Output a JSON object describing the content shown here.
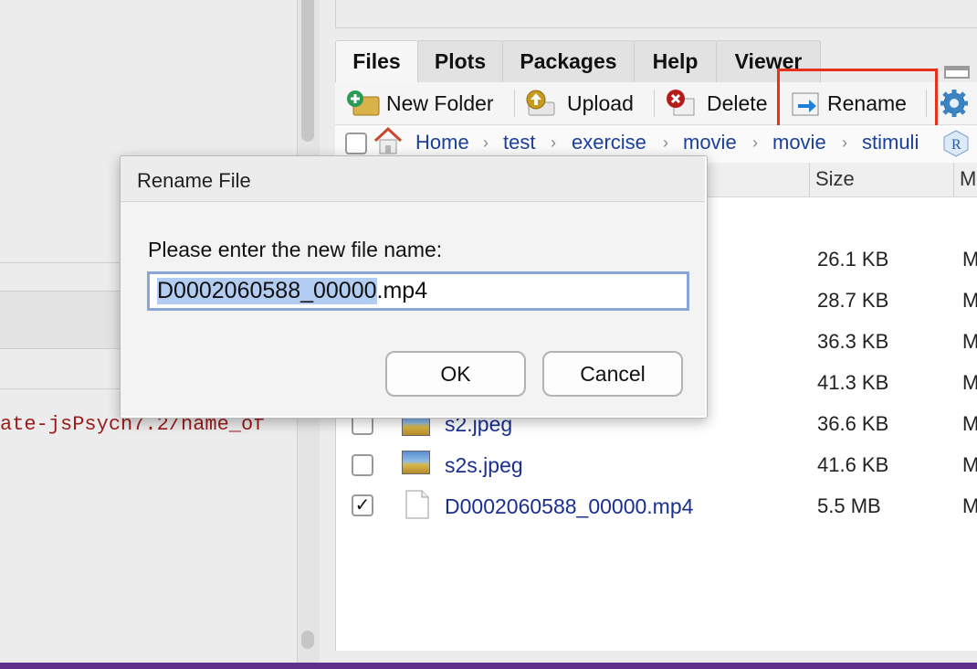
{
  "left_pane": {
    "code_snippet": "ate-jsPsych7.2/name_of"
  },
  "files_pane": {
    "tabs": [
      {
        "label": "Files",
        "active": true
      },
      {
        "label": "Plots",
        "active": false
      },
      {
        "label": "Packages",
        "active": false
      },
      {
        "label": "Help",
        "active": false
      },
      {
        "label": "Viewer",
        "active": false
      }
    ],
    "toolbar": {
      "new_folder": "New Folder",
      "upload": "Upload",
      "delete": "Delete",
      "rename": "Rename"
    },
    "breadcrumb": [
      "Home",
      "test",
      "exercise",
      "movie",
      "movie",
      "stimuli"
    ],
    "columns": {
      "size": "Size",
      "modified": "M"
    },
    "rows": [
      {
        "name": "",
        "size": "26.1 KB",
        "modified": "M",
        "checked": false
      },
      {
        "name": "",
        "size": "28.7 KB",
        "modified": "M",
        "checked": false
      },
      {
        "name": "",
        "size": "36.3 KB",
        "modified": "M",
        "checked": false
      },
      {
        "name": "",
        "size": "41.3 KB",
        "modified": "M",
        "checked": false
      },
      {
        "name": "s2.jpeg",
        "size": "36.6 KB",
        "modified": "M",
        "checked": false
      },
      {
        "name": "s2s.jpeg",
        "size": "41.6 KB",
        "modified": "M",
        "checked": false
      },
      {
        "name": "D0002060588_00000.mp4",
        "size": "5.5 MB",
        "modified": "M",
        "checked": true
      }
    ]
  },
  "dialog": {
    "title": "Rename File",
    "prompt": "Please enter the new file name:",
    "input_selected": "D0002060588_00000",
    "input_rest": ".mp4",
    "ok_label": "OK",
    "cancel_label": "Cancel"
  },
  "colors": {
    "highlight_box": "#e8311a",
    "link": "#1a2f8f",
    "code_text": "#9a1b1b",
    "bottom_bar": "#5f2f8a"
  }
}
